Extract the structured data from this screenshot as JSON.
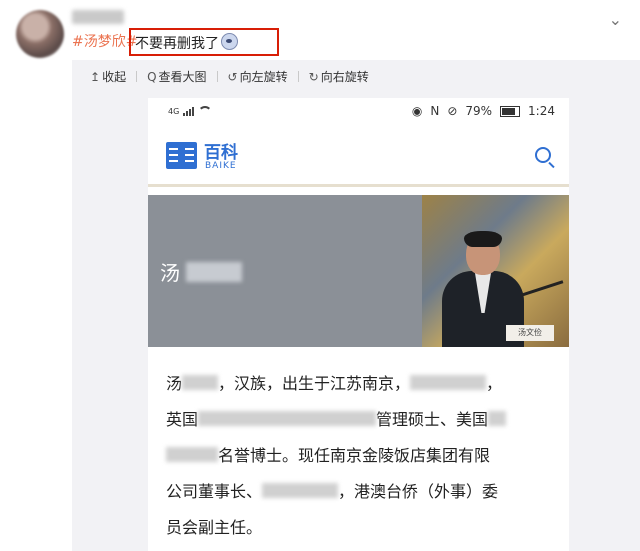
{
  "post": {
    "hashtag": "#汤梦欣#",
    "message": "不要再删我了",
    "emoji_icon": "crying-face-emoji"
  },
  "toolbar": {
    "collapse_icon": "↥",
    "collapse_label": "收起",
    "view_large_icon": "Q",
    "view_large_label": "查看大图",
    "rotate_left_icon": "↺",
    "rotate_left_label": "向左旋转",
    "rotate_right_icon": "↻",
    "rotate_right_label": "向右旋转"
  },
  "phone_status": {
    "network": "4G",
    "battery": "79%",
    "time": "1:24"
  },
  "baike": {
    "logo_text": "百科",
    "logo_sub": "BAIKE"
  },
  "hero": {
    "name_prefix": "汤",
    "nameplate": "汤文俭"
  },
  "article": {
    "line1_a": "汤",
    "line1_b": "，汉族，出生于江苏南京，",
    "line1_c": "，",
    "line2_a": "英国",
    "line2_b": "管理硕士、美国",
    "line3_a": "名誉博士。现任南京金陵饭店集团有限",
    "line4_a": "公司董事长、",
    "line4_b": "，港澳台侨（外事）委",
    "line5_a": "员会副主任。"
  },
  "colors": {
    "hashtag": "#eb7350",
    "highlight_border": "#d81e06",
    "baike_blue": "#2f6fd2",
    "hero_bg": "#8b9097"
  }
}
